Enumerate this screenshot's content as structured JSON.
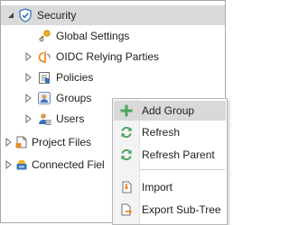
{
  "tree": {
    "items": [
      {
        "label": "Security",
        "icon": "shield-icon",
        "expanded": true
      },
      {
        "label": "Global Settings",
        "icon": "key-gear-icon"
      },
      {
        "label": "OIDC Relying Parties",
        "icon": "oidc-icon"
      },
      {
        "label": "Policies",
        "icon": "policies-icon"
      },
      {
        "label": "Groups",
        "icon": "groups-icon"
      },
      {
        "label": "Users",
        "icon": "users-icon"
      },
      {
        "label": "Project Files",
        "icon": "project-files-icon"
      },
      {
        "label": "Connected Fiel",
        "icon": "connected-fields-icon"
      }
    ]
  },
  "context_menu": {
    "items": [
      {
        "label": "Add Group",
        "icon": "plus-icon"
      },
      {
        "label": "Refresh",
        "icon": "refresh-icon"
      },
      {
        "label": "Refresh Parent",
        "icon": "refresh-parent-icon"
      },
      {
        "label": "Import",
        "icon": "import-icon"
      },
      {
        "label": "Export Sub-Tree",
        "icon": "export-icon"
      }
    ]
  },
  "colors": {
    "selection": "#dadada",
    "menu_highlight": "#d9d9d9",
    "accent_green": "#4aa564",
    "accent_orange": "#f08a24",
    "accent_blue": "#3b73b9"
  }
}
